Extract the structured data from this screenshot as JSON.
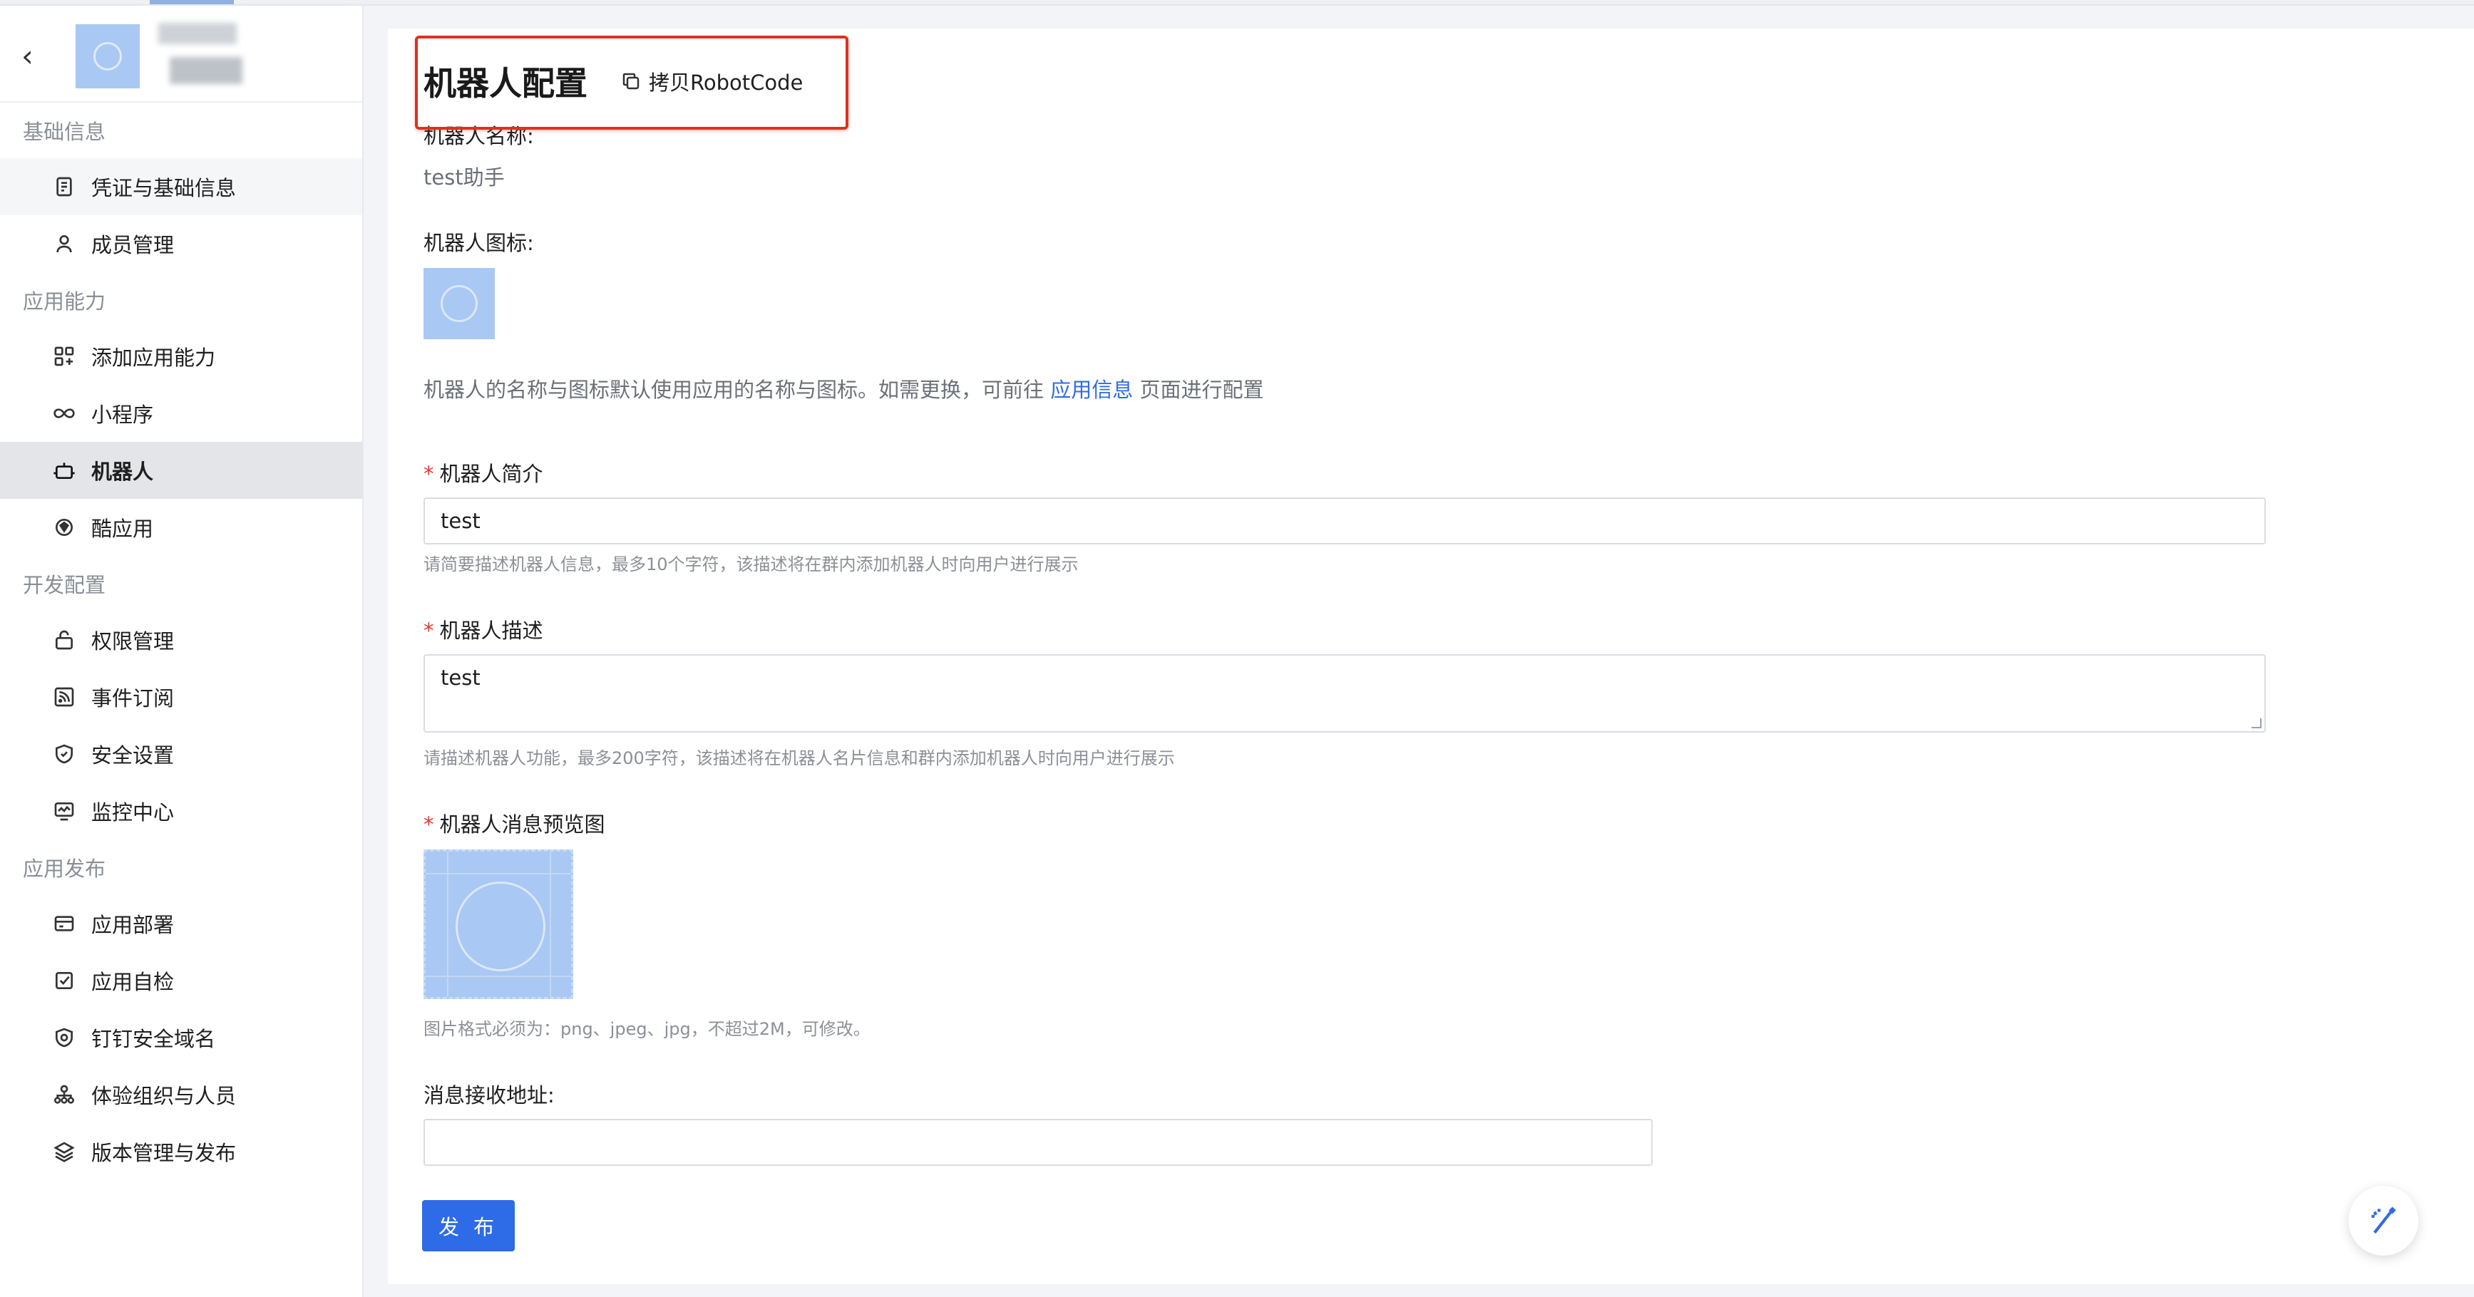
{
  "sidebar": {
    "back_icon": "chevron-left-icon",
    "groups": [
      {
        "title": "基础信息",
        "items": [
          {
            "label": "凭证与基础信息",
            "icon": "credential-icon"
          },
          {
            "label": "成员管理",
            "icon": "user-icon"
          }
        ]
      },
      {
        "title": "应用能力",
        "items": [
          {
            "label": "添加应用能力",
            "icon": "add-capability-icon"
          },
          {
            "label": "小程序",
            "icon": "mini-program-icon"
          },
          {
            "label": "机器人",
            "icon": "robot-icon"
          },
          {
            "label": "酷应用",
            "icon": "cool-app-icon"
          }
        ]
      },
      {
        "title": "开发配置",
        "items": [
          {
            "label": "权限管理",
            "icon": "permission-icon"
          },
          {
            "label": "事件订阅",
            "icon": "rss-icon"
          },
          {
            "label": "安全设置",
            "icon": "shield-icon"
          },
          {
            "label": "监控中心",
            "icon": "monitor-icon"
          }
        ]
      },
      {
        "title": "应用发布",
        "items": [
          {
            "label": "应用部署",
            "icon": "deploy-icon"
          },
          {
            "label": "应用自检",
            "icon": "checklist-icon"
          },
          {
            "label": "钉钉安全域名",
            "icon": "domain-shield-icon"
          },
          {
            "label": "体验组织与人员",
            "icon": "org-icon"
          },
          {
            "label": "版本管理与发布",
            "icon": "layers-icon"
          }
        ]
      }
    ]
  },
  "main": {
    "title": "机器人配置",
    "copy_button": "拷贝RobotCode",
    "name_label": "机器人名称:",
    "name_value": "test助手",
    "icon_label": "机器人图标:",
    "note_prefix": "机器人的名称与图标默认使用应用的名称与图标。如需更换，可前往",
    "note_link": "应用信息",
    "note_suffix": "页面进行配置",
    "intro": {
      "required": "*",
      "label": "机器人简介",
      "value": "test",
      "hint": "请简要描述机器人信息，最多10个字符，该描述将在群内添加机器人时向用户进行展示"
    },
    "description": {
      "required": "*",
      "label": "机器人描述",
      "value": "test",
      "hint": "请描述机器人功能，最多200字符，该描述将在机器人名片信息和群内添加机器人时向用户进行展示"
    },
    "preview": {
      "required": "*",
      "label": "机器人消息预览图",
      "hint": "图片格式必须为：png、jpeg、jpg，不超过2M，可修改。"
    },
    "endpoint": {
      "label": "消息接收地址:",
      "value": ""
    },
    "publish_button": "发 布"
  },
  "colors": {
    "primary": "#2e6be6",
    "required": "#e53935",
    "highlight_box": "#e0301e",
    "active_nav": "#e3e5e8"
  }
}
